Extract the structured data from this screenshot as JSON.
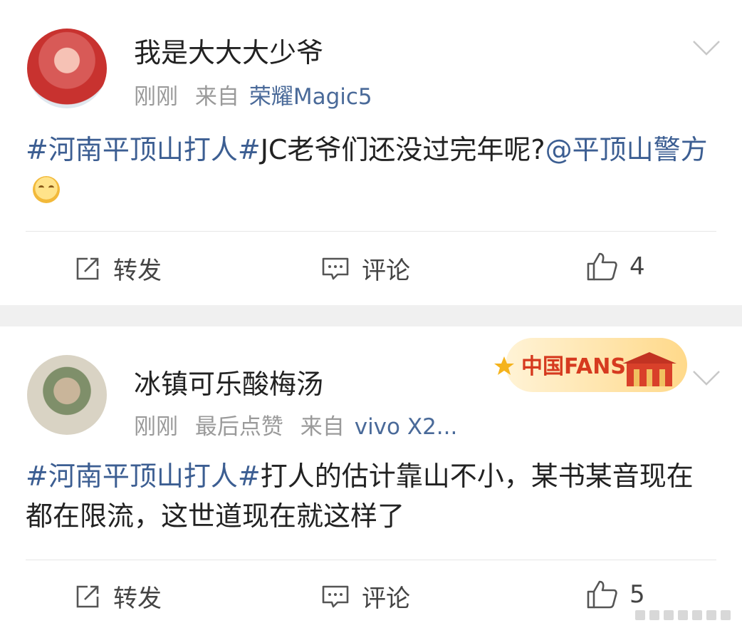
{
  "posts": [
    {
      "username": "我是大大大少爷",
      "time": "刚刚",
      "source_prefix": "来自",
      "source": "荣耀Magic5",
      "text": {
        "tag": "#河南平顶山打人#",
        "body": "JC老爷们还没过完年呢?",
        "mention": "@平顶山警方"
      },
      "emoji_icon": "smile-emoji-icon",
      "actions": {
        "share_label": "转发",
        "comment_label": "评论",
        "like_count": "4"
      }
    },
    {
      "username": "冰镇可乐酸梅汤",
      "time": "刚刚",
      "extra": "最后点赞",
      "source_prefix": "来自",
      "source": "vivo X2...",
      "badge_text": "中国FANS",
      "text": {
        "tag": "#河南平顶山打人#",
        "body": "打人的估计靠山不小，某书某音现在都在限流，这世道现在就这样了"
      },
      "actions": {
        "share_label": "转发",
        "comment_label": "评论",
        "like_count": "5"
      }
    }
  ],
  "colors": {
    "link": "#3c5e92",
    "meta": "#9a9a9a",
    "separator": "#f0f0f0"
  }
}
